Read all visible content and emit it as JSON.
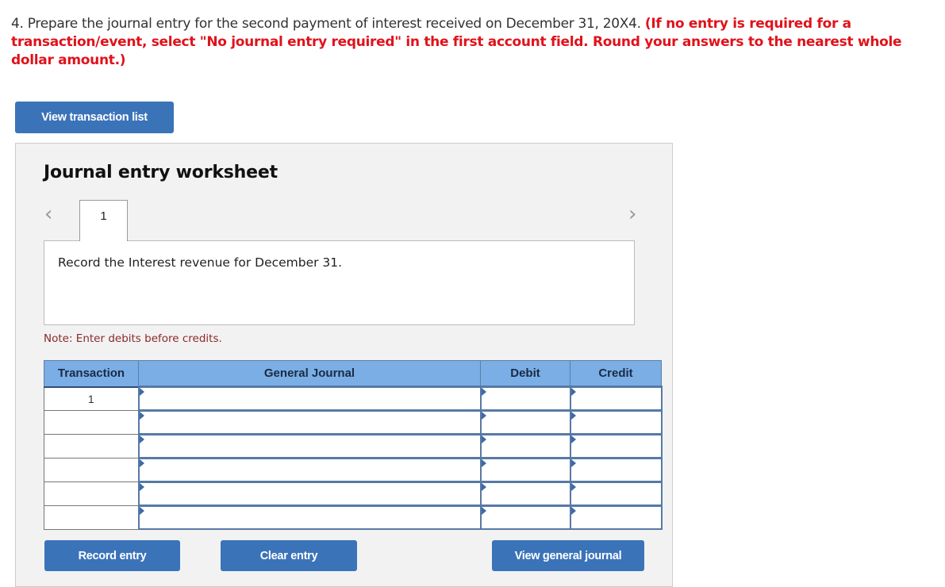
{
  "question": {
    "text": "4. Prepare the journal entry for the second payment of interest received on December 31, 20X4.",
    "instructions": "(If no entry is required for a transaction/event, select \"No journal entry required\" in the first account field. Round your answers to the nearest whole dollar amount.)"
  },
  "buttons": {
    "view_transaction_list": "View transaction list",
    "record_entry": "Record entry",
    "clear_entry": "Clear entry",
    "view_general_journal": "View general journal"
  },
  "worksheet": {
    "title": "Journal entry worksheet",
    "prev_icon": "‹",
    "next_icon": "›",
    "tabs": [
      {
        "label": "1"
      }
    ],
    "description": "Record the Interest revenue for December 31.",
    "note": "Note: Enter debits before credits."
  },
  "journal": {
    "headers": {
      "transaction": "Transaction",
      "general_journal": "General Journal",
      "debit": "Debit",
      "credit": "Credit"
    },
    "rows": [
      {
        "transaction": "1",
        "account": "",
        "debit": "",
        "credit": ""
      },
      {
        "transaction": "",
        "account": "",
        "debit": "",
        "credit": ""
      },
      {
        "transaction": "",
        "account": "",
        "debit": "",
        "credit": ""
      },
      {
        "transaction": "",
        "account": "",
        "debit": "",
        "credit": ""
      },
      {
        "transaction": "",
        "account": "",
        "debit": "",
        "credit": ""
      },
      {
        "transaction": "",
        "account": "",
        "debit": "",
        "credit": ""
      }
    ]
  },
  "colors": {
    "button_blue": "#3b73b9",
    "header_blue": "#7aaee5",
    "instruction_red": "#e0121b",
    "note_red": "#8b2a2a"
  }
}
